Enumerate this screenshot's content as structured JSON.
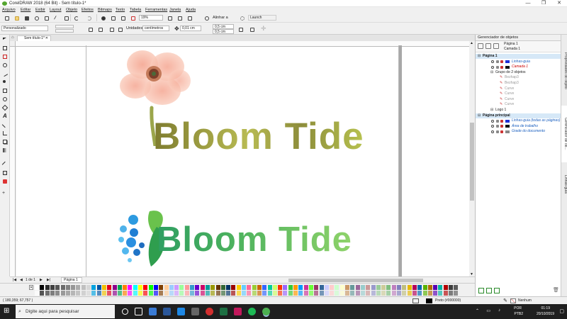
{
  "window": {
    "title": "CorelDRAW 2018 (64 Bit) - Sem título-1*",
    "controls": [
      "—",
      "❐",
      "✕"
    ]
  },
  "menu": [
    "Arquivo",
    "Editar",
    "Exibir",
    "Layout",
    "Objeto",
    "Efeitos",
    "Bitmaps",
    "Texto",
    "Tabela",
    "Ferramentas",
    "Janela",
    "Ajuda"
  ],
  "toolbar": {
    "zoom": "19%",
    "align_label": "Alinhar a",
    "launch_label": "Launch"
  },
  "propertybar": {
    "preset": "Personalizado",
    "units_label": "Unidades:",
    "units_value": "centímetros",
    "nudge": "0,01 cm",
    "dup_x": "0,5 cm",
    "dup_y": "0,5 cm"
  },
  "document": {
    "tab_label": "Sem título-1*",
    "logo_top_text": "Bloom Tide",
    "logo_bottom_text": "Bloom Tide",
    "page_nav": "1 de 1",
    "page_tab": "Página 1"
  },
  "object_manager": {
    "title": "Gerenciador de objetos",
    "current_page": "Página 1",
    "current_layer": "Camada 1",
    "rows": [
      {
        "label": "Página 1",
        "style": "bold",
        "indent": 0,
        "icons": false
      },
      {
        "label": "Linhas-guia",
        "style": "blue",
        "indent": 2,
        "icons": true,
        "color": "#1e2fd6"
      },
      {
        "label": "Camada 1",
        "style": "red",
        "indent": 2,
        "icons": true,
        "color": "#111111"
      },
      {
        "label": "Grupo de 2 objetos",
        "style": "normal",
        "indent": 3,
        "icons": false
      },
      {
        "label": "Bezhap3",
        "style": "dim",
        "indent": 4,
        "icons": false
      },
      {
        "label": "Bezhap3",
        "style": "dim",
        "indent": 4,
        "icons": false
      },
      {
        "label": "Curve",
        "style": "dim",
        "indent": 4,
        "icons": false
      },
      {
        "label": "Curve",
        "style": "dim",
        "indent": 4,
        "icons": false
      },
      {
        "label": "Curve",
        "style": "dim",
        "indent": 4,
        "icons": false
      },
      {
        "label": "Curve",
        "style": "dim",
        "indent": 4,
        "icons": false
      },
      {
        "label": "Logo 1",
        "style": "normal",
        "indent": 3,
        "icons": false
      },
      {
        "label": "Página principal",
        "style": "bold",
        "indent": 0,
        "icons": false
      },
      {
        "label": "Linhas-guia (todas as páginas)",
        "style": "blue",
        "indent": 2,
        "icons": true,
        "color": "#1e2fd6"
      },
      {
        "label": "Área de trabalho",
        "style": "blue",
        "indent": 2,
        "icons": true,
        "color": "#111111"
      },
      {
        "label": "Grade do documento",
        "style": "blue",
        "indent": 2,
        "icons": true,
        "color": "#888888"
      }
    ]
  },
  "side_tabs": [
    "Propriedades do objeto",
    "Gerenciador de ob...",
    "Linhas-guia"
  ],
  "status": {
    "coords": "( 180,359; 67,757 )",
    "fill": "Preto (#000000)",
    "outline": "Nenhum"
  },
  "taskbar": {
    "search_placeholder": "Digite aqui para pesquisar",
    "lang": "POR",
    "lang2": "PTB2",
    "time": "01:19",
    "date": "20/10/2019"
  },
  "colors": {
    "logo_top": "#9aa640",
    "logo_bottom_start": "#2e9e62",
    "logo_bottom_end": "#8fd36a",
    "taskbar": "#1f1f1f"
  },
  "palette": [
    "#ffffff",
    "#000000",
    "#2a2a2a",
    "#404040",
    "#555555",
    "#6b6b6b",
    "#808080",
    "#969696",
    "#abab ab",
    "#c0c0c0",
    "#d6d6d6",
    "#00a3e0",
    "#0055a5",
    "#f0c000",
    "#e2001a",
    "#8b008b",
    "#00a650",
    "#ff7f00",
    "#ff00ff",
    "#00ffff",
    "#ffff00",
    "#ff0000",
    "#00ff00",
    "#0000ff",
    "#7f3f00",
    "#ffcc99",
    "#99ccff",
    "#cc99ff",
    "#99ff99",
    "#ff9999",
    "#3399cc",
    "#6600cc",
    "#cc0066",
    "#009999",
    "#999900",
    "#663300",
    "#336633",
    "#003366",
    "#990000",
    "#ffcc00",
    "#66ccff",
    "#ff6699",
    "#99cc33",
    "#cc6600",
    "#3366ff",
    "#00cc99",
    "#ccff66",
    "#ff3300",
    "#9966ff",
    "#33cc33",
    "#ff9900",
    "#0099ff",
    "#cc3399",
    "#66ff33",
    "#993366",
    "#336699",
    "#ccccff",
    "#ffcccc",
    "#ccffcc",
    "#ffffcc",
    "#cc9966",
    "#669999",
    "#996699",
    "#99cccc",
    "#cc9999",
    "#9999cc",
    "#99cc99",
    "#cccc99",
    "#7fbf7f",
    "#bf7fbf",
    "#7f7fbf",
    "#bfbf7f",
    "#e6b800",
    "#b30059",
    "#0066b3",
    "#59b300",
    "#b36b00",
    "#5900b3",
    "#00b3a1",
    "#b30000",
    "#3d3d3d",
    "#5c5c5c"
  ]
}
